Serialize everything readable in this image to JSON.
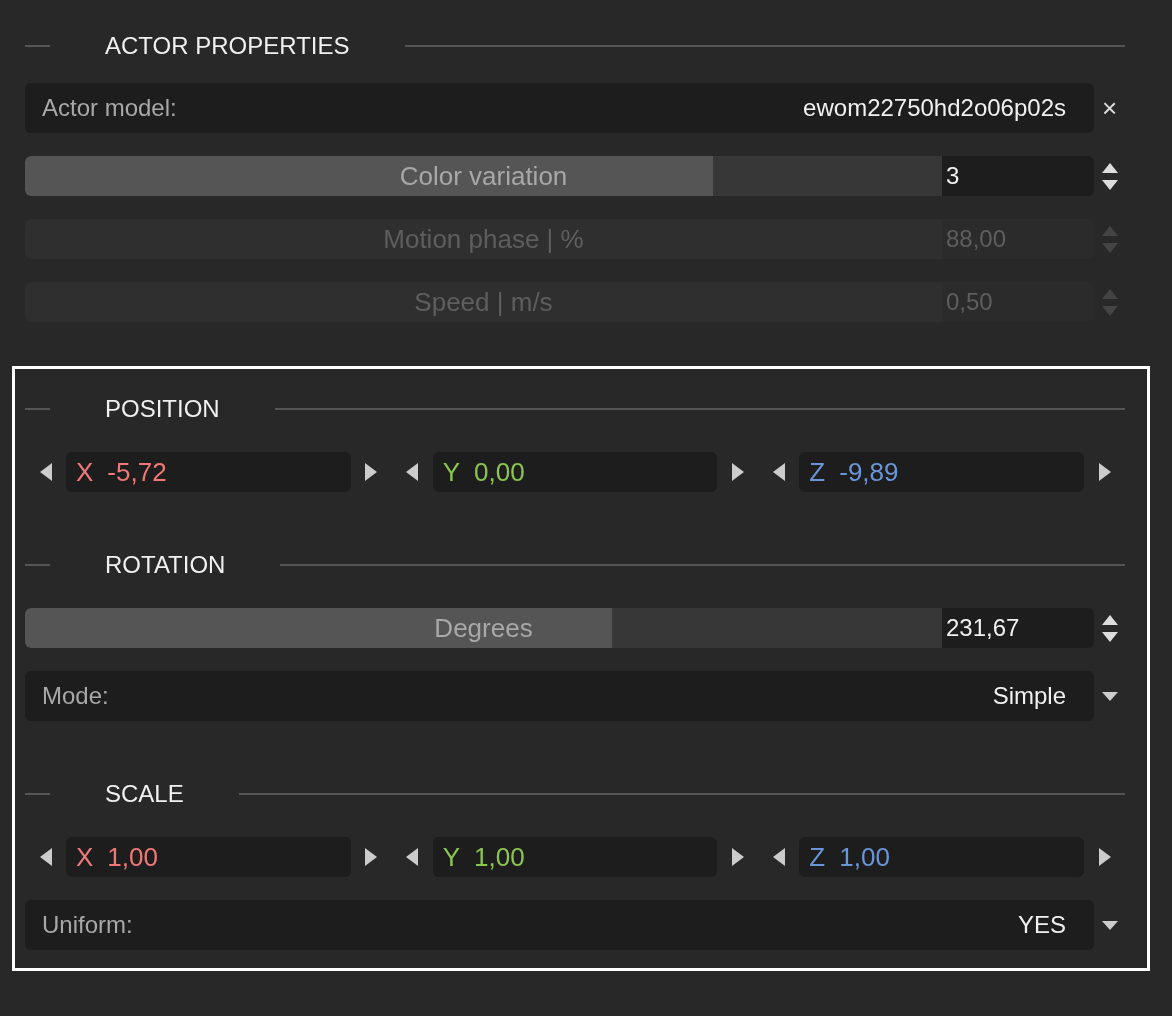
{
  "panels": [
    {
      "highlighted": false,
      "sections": [
        {
          "title": "ACTOR PROPERTIES",
          "rows": [
            {
              "kind": "text",
              "label": "Actor model:",
              "value": "ewom22750hd2o06p02s",
              "clear": "×"
            },
            {
              "kind": "slider",
              "label": "Color variation",
              "value": "3",
              "level": 0.75,
              "disabled": false
            },
            {
              "kind": "slider",
              "label": "Motion phase | %",
              "value": "88,00",
              "disabled": true
            },
            {
              "kind": "slider",
              "label": "Speed | m/s",
              "value": "0,50",
              "disabled": true
            }
          ]
        }
      ]
    },
    {
      "highlighted": true,
      "sections": [
        {
          "title": "POSITION",
          "rows": [
            {
              "kind": "vector",
              "components": [
                {
                  "axis": "X",
                  "value": "-5,72",
                  "color": "#f07878"
                },
                {
                  "axis": "Y",
                  "value": "0,00",
                  "color": "#8cc450"
                },
                {
                  "axis": "Z",
                  "value": "-9,89",
                  "color": "#6a96d8"
                }
              ]
            }
          ]
        },
        {
          "title": "ROTATION",
          "rows": [
            {
              "kind": "slider",
              "label": "Degrees",
              "value": "231,67",
              "level": 0.64,
              "disabled": false
            },
            {
              "kind": "dropdown",
              "label": "Mode:",
              "value": "Simple"
            }
          ]
        },
        {
          "title": "SCALE",
          "rows": [
            {
              "kind": "vector",
              "components": [
                {
                  "axis": "X",
                  "value": "1,00",
                  "color": "#f07878"
                },
                {
                  "axis": "Y",
                  "value": "1,00",
                  "color": "#8cc450"
                },
                {
                  "axis": "Z",
                  "value": "1,00",
                  "color": "#6a96d8"
                }
              ]
            },
            {
              "kind": "dropdown",
              "label": "Uniform:",
              "value": "YES"
            }
          ]
        }
      ]
    }
  ]
}
